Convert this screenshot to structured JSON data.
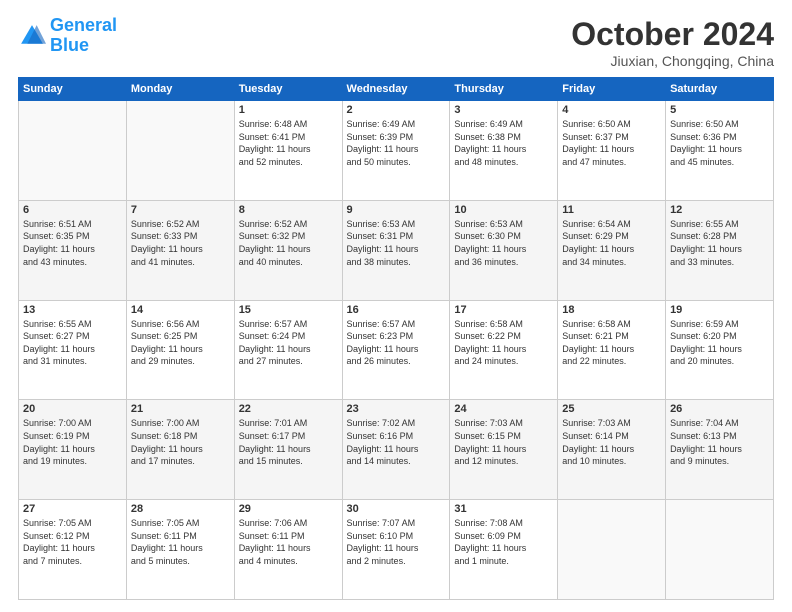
{
  "header": {
    "logo_general": "General",
    "logo_blue": "Blue",
    "month_title": "October 2024",
    "location": "Jiuxian, Chongqing, China"
  },
  "weekdays": [
    "Sunday",
    "Monday",
    "Tuesday",
    "Wednesday",
    "Thursday",
    "Friday",
    "Saturday"
  ],
  "weeks": [
    [
      {
        "day": "",
        "lines": []
      },
      {
        "day": "",
        "lines": []
      },
      {
        "day": "1",
        "lines": [
          "Sunrise: 6:48 AM",
          "Sunset: 6:41 PM",
          "Daylight: 11 hours",
          "and 52 minutes."
        ]
      },
      {
        "day": "2",
        "lines": [
          "Sunrise: 6:49 AM",
          "Sunset: 6:39 PM",
          "Daylight: 11 hours",
          "and 50 minutes."
        ]
      },
      {
        "day": "3",
        "lines": [
          "Sunrise: 6:49 AM",
          "Sunset: 6:38 PM",
          "Daylight: 11 hours",
          "and 48 minutes."
        ]
      },
      {
        "day": "4",
        "lines": [
          "Sunrise: 6:50 AM",
          "Sunset: 6:37 PM",
          "Daylight: 11 hours",
          "and 47 minutes."
        ]
      },
      {
        "day": "5",
        "lines": [
          "Sunrise: 6:50 AM",
          "Sunset: 6:36 PM",
          "Daylight: 11 hours",
          "and 45 minutes."
        ]
      }
    ],
    [
      {
        "day": "6",
        "lines": [
          "Sunrise: 6:51 AM",
          "Sunset: 6:35 PM",
          "Daylight: 11 hours",
          "and 43 minutes."
        ]
      },
      {
        "day": "7",
        "lines": [
          "Sunrise: 6:52 AM",
          "Sunset: 6:33 PM",
          "Daylight: 11 hours",
          "and 41 minutes."
        ]
      },
      {
        "day": "8",
        "lines": [
          "Sunrise: 6:52 AM",
          "Sunset: 6:32 PM",
          "Daylight: 11 hours",
          "and 40 minutes."
        ]
      },
      {
        "day": "9",
        "lines": [
          "Sunrise: 6:53 AM",
          "Sunset: 6:31 PM",
          "Daylight: 11 hours",
          "and 38 minutes."
        ]
      },
      {
        "day": "10",
        "lines": [
          "Sunrise: 6:53 AM",
          "Sunset: 6:30 PM",
          "Daylight: 11 hours",
          "and 36 minutes."
        ]
      },
      {
        "day": "11",
        "lines": [
          "Sunrise: 6:54 AM",
          "Sunset: 6:29 PM",
          "Daylight: 11 hours",
          "and 34 minutes."
        ]
      },
      {
        "day": "12",
        "lines": [
          "Sunrise: 6:55 AM",
          "Sunset: 6:28 PM",
          "Daylight: 11 hours",
          "and 33 minutes."
        ]
      }
    ],
    [
      {
        "day": "13",
        "lines": [
          "Sunrise: 6:55 AM",
          "Sunset: 6:27 PM",
          "Daylight: 11 hours",
          "and 31 minutes."
        ]
      },
      {
        "day": "14",
        "lines": [
          "Sunrise: 6:56 AM",
          "Sunset: 6:25 PM",
          "Daylight: 11 hours",
          "and 29 minutes."
        ]
      },
      {
        "day": "15",
        "lines": [
          "Sunrise: 6:57 AM",
          "Sunset: 6:24 PM",
          "Daylight: 11 hours",
          "and 27 minutes."
        ]
      },
      {
        "day": "16",
        "lines": [
          "Sunrise: 6:57 AM",
          "Sunset: 6:23 PM",
          "Daylight: 11 hours",
          "and 26 minutes."
        ]
      },
      {
        "day": "17",
        "lines": [
          "Sunrise: 6:58 AM",
          "Sunset: 6:22 PM",
          "Daylight: 11 hours",
          "and 24 minutes."
        ]
      },
      {
        "day": "18",
        "lines": [
          "Sunrise: 6:58 AM",
          "Sunset: 6:21 PM",
          "Daylight: 11 hours",
          "and 22 minutes."
        ]
      },
      {
        "day": "19",
        "lines": [
          "Sunrise: 6:59 AM",
          "Sunset: 6:20 PM",
          "Daylight: 11 hours",
          "and 20 minutes."
        ]
      }
    ],
    [
      {
        "day": "20",
        "lines": [
          "Sunrise: 7:00 AM",
          "Sunset: 6:19 PM",
          "Daylight: 11 hours",
          "and 19 minutes."
        ]
      },
      {
        "day": "21",
        "lines": [
          "Sunrise: 7:00 AM",
          "Sunset: 6:18 PM",
          "Daylight: 11 hours",
          "and 17 minutes."
        ]
      },
      {
        "day": "22",
        "lines": [
          "Sunrise: 7:01 AM",
          "Sunset: 6:17 PM",
          "Daylight: 11 hours",
          "and 15 minutes."
        ]
      },
      {
        "day": "23",
        "lines": [
          "Sunrise: 7:02 AM",
          "Sunset: 6:16 PM",
          "Daylight: 11 hours",
          "and 14 minutes."
        ]
      },
      {
        "day": "24",
        "lines": [
          "Sunrise: 7:03 AM",
          "Sunset: 6:15 PM",
          "Daylight: 11 hours",
          "and 12 minutes."
        ]
      },
      {
        "day": "25",
        "lines": [
          "Sunrise: 7:03 AM",
          "Sunset: 6:14 PM",
          "Daylight: 11 hours",
          "and 10 minutes."
        ]
      },
      {
        "day": "26",
        "lines": [
          "Sunrise: 7:04 AM",
          "Sunset: 6:13 PM",
          "Daylight: 11 hours",
          "and 9 minutes."
        ]
      }
    ],
    [
      {
        "day": "27",
        "lines": [
          "Sunrise: 7:05 AM",
          "Sunset: 6:12 PM",
          "Daylight: 11 hours",
          "and 7 minutes."
        ]
      },
      {
        "day": "28",
        "lines": [
          "Sunrise: 7:05 AM",
          "Sunset: 6:11 PM",
          "Daylight: 11 hours",
          "and 5 minutes."
        ]
      },
      {
        "day": "29",
        "lines": [
          "Sunrise: 7:06 AM",
          "Sunset: 6:11 PM",
          "Daylight: 11 hours",
          "and 4 minutes."
        ]
      },
      {
        "day": "30",
        "lines": [
          "Sunrise: 7:07 AM",
          "Sunset: 6:10 PM",
          "Daylight: 11 hours",
          "and 2 minutes."
        ]
      },
      {
        "day": "31",
        "lines": [
          "Sunrise: 7:08 AM",
          "Sunset: 6:09 PM",
          "Daylight: 11 hours",
          "and 1 minute."
        ]
      },
      {
        "day": "",
        "lines": []
      },
      {
        "day": "",
        "lines": []
      }
    ]
  ]
}
